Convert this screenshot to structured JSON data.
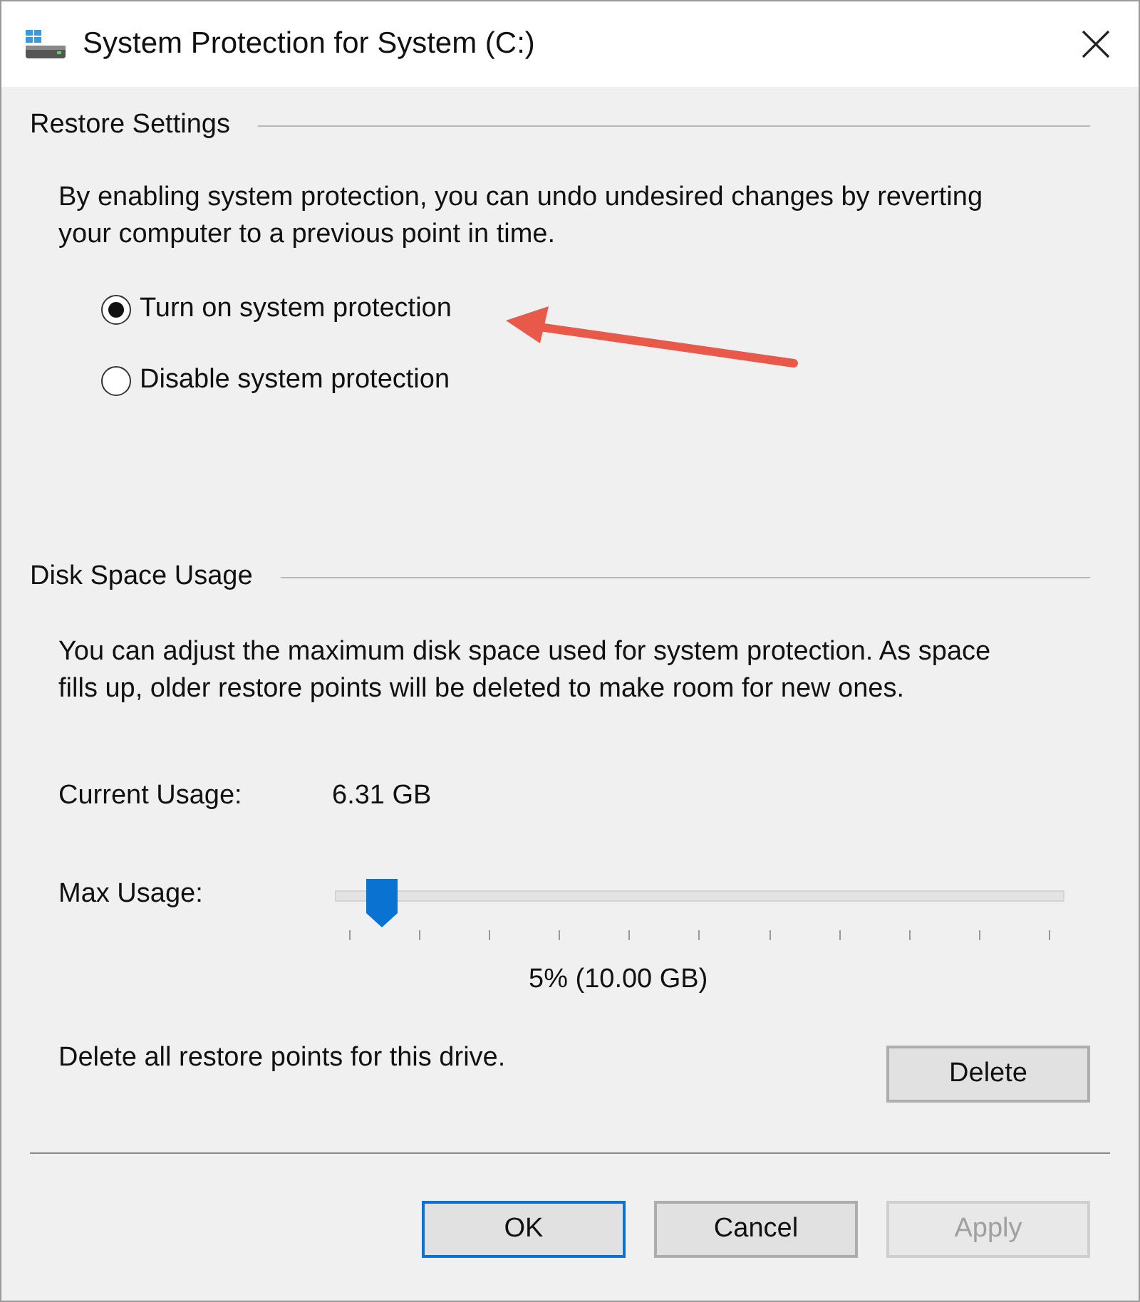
{
  "window": {
    "title": "System Protection for System (C:)"
  },
  "restore_settings": {
    "heading": "Restore Settings",
    "description": "By enabling system protection, you can undo undesired changes by reverting your computer to a previous point in time.",
    "options": [
      {
        "label": "Turn on system protection",
        "selected": true
      },
      {
        "label": "Disable system protection",
        "selected": false
      }
    ]
  },
  "disk_space_usage": {
    "heading": "Disk Space Usage",
    "description": "You can adjust the maximum disk space used for system protection. As space fills up, older restore points will be deleted to make room for new ones.",
    "current_usage": {
      "label": "Current Usage:",
      "value": "6.31 GB"
    },
    "max_usage": {
      "label": "Max Usage:",
      "level": 0.057,
      "reading": "5% (10.00 GB)"
    },
    "delete_text": "Delete all restore points for this drive.",
    "delete_button": "Delete"
  },
  "buttons": [
    {
      "label": "OK",
      "default": true,
      "disabled": false
    },
    {
      "label": "Cancel",
      "default": false,
      "disabled": false
    },
    {
      "label": "Apply",
      "default": false,
      "disabled": true
    }
  ]
}
